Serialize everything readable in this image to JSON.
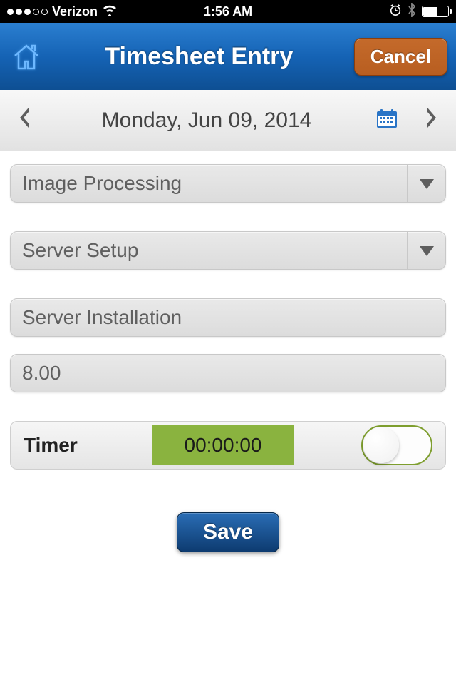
{
  "status": {
    "carrier": "Verizon",
    "time": "1:56 AM"
  },
  "header": {
    "title": "Timesheet Entry",
    "cancel_label": "Cancel"
  },
  "date_bar": {
    "date_text": "Monday, Jun 09, 2014"
  },
  "form": {
    "project": "Image Processing",
    "task": "Server Setup",
    "subtask": "Server Installation",
    "hours": "8.00"
  },
  "timer": {
    "label": "Timer",
    "display": "00:00:00"
  },
  "actions": {
    "save_label": "Save"
  }
}
